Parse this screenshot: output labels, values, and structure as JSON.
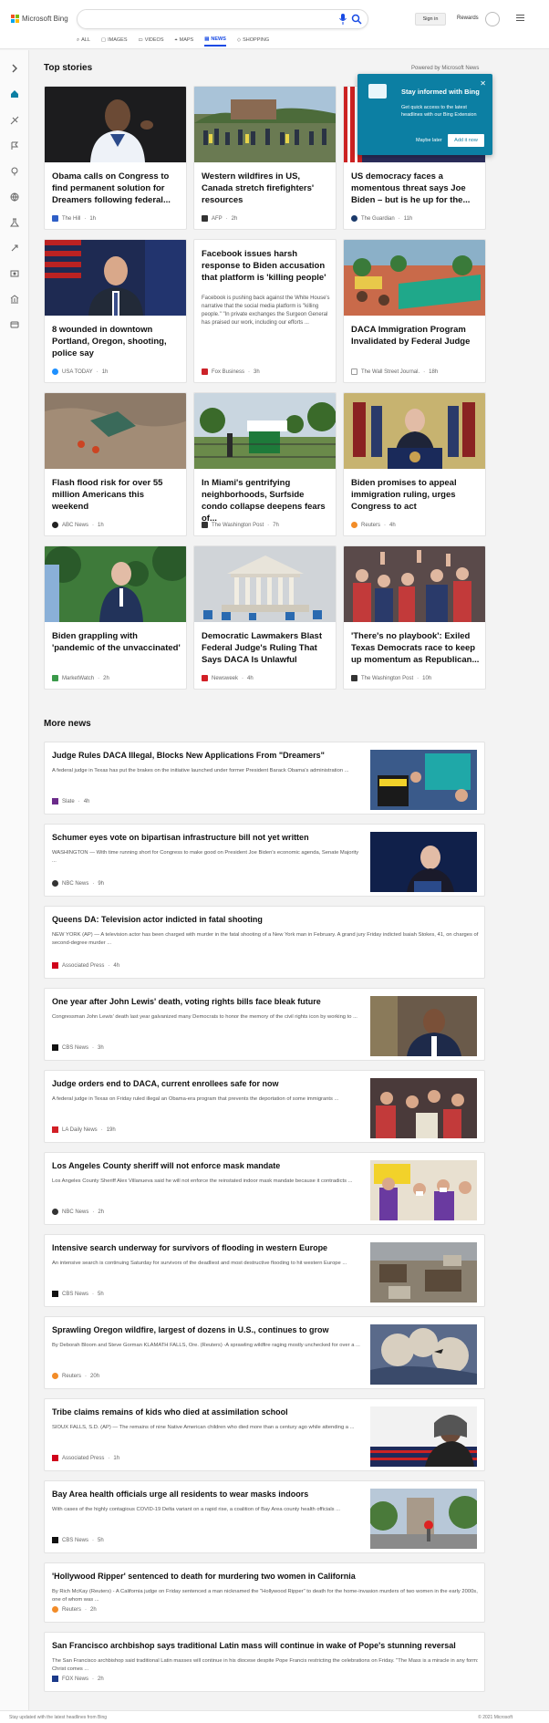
{
  "brand": {
    "name": "Microsoft Bing"
  },
  "header": {
    "signin_label": "Sign in",
    "rewards_label": "Rewards",
    "tabs": [
      {
        "label": "ALL",
        "icon": "search-icon"
      },
      {
        "label": "IMAGES",
        "icon": "image-icon"
      },
      {
        "label": "VIDEOS",
        "icon": "video-icon"
      },
      {
        "label": "MAPS",
        "icon": "map-pin-icon"
      },
      {
        "label": "NEWS",
        "icon": "news-icon",
        "active": true
      },
      {
        "label": "SHOPPING",
        "icon": "tag-icon"
      }
    ]
  },
  "sidebar": {
    "icons": [
      "expand-icon",
      "home-icon",
      "discover-icon",
      "flag-icon",
      "location-icon",
      "world-icon",
      "science-icon",
      "tech-icon",
      "entertainment-icon",
      "business-icon",
      "money-icon"
    ]
  },
  "top_stories": {
    "title": "Top stories",
    "powered_by": "Powered by Microsoft News",
    "cards": [
      {
        "title": "Obama calls on Congress to find permanent solution for Dreamers following federal...",
        "source": "The Hill",
        "time": "1h",
        "color": "#2f5fc7"
      },
      {
        "title": "Western wildfires in US, Canada stretch firefighters' resources",
        "source": "AFP",
        "time": "2h",
        "color": "#333333"
      },
      {
        "title": "US democracy faces a momentous threat says Joe Biden – but is he up for the...",
        "source": "The Guardian",
        "time": "11h",
        "color": "#1b3a6b"
      },
      {
        "title": "8 wounded in downtown Portland, Oregon, shooting, police say",
        "source": "USA TODAY",
        "time": "1h",
        "color": "#1e90ff"
      },
      {
        "title": "Facebook issues harsh response to Biden accusation that platform is 'killing people'",
        "desc": "Facebook is pushing back against the White House's narrative that the social media platform is \"killing people.\" \"In private exchanges the Surgeon General has praised our work, including our efforts ...",
        "source": "Fox Business",
        "time": "3h",
        "color": "#cc2229"
      },
      {
        "title": "DACA Immigration Program Invalidated by Federal Judge",
        "source": "The Wall Street Journal.",
        "time": "18h",
        "color": "#666666"
      },
      {
        "title": "Flash flood risk for over 55 million Americans this weekend",
        "source": "ABC News",
        "time": "1h",
        "color": "#222222"
      },
      {
        "title": "In Miami's gentrifying neighborhoods, Surfside condo collapse deepens fears of...",
        "source": "The Washington Post",
        "time": "7h",
        "color": "#333333"
      },
      {
        "title": "Biden promises to appeal immigration ruling, urges Congress to act",
        "source": "Reuters",
        "time": "4h",
        "color": "#f28c28"
      },
      {
        "title": "Biden grappling with 'pandemic of the unvaccinated'",
        "source": "MarketWatch",
        "time": "2h",
        "color": "#3a9a4a"
      },
      {
        "title": "Democratic Lawmakers Blast Federal Judge's Ruling That Says DACA Is Unlawful",
        "source": "Newsweek",
        "time": "4h",
        "color": "#d21f26"
      },
      {
        "title": "'There's no playbook': Exiled Texas Democrats race to keep up momentum as Republican...",
        "source": "The Washington Post",
        "time": "10h",
        "color": "#333333"
      }
    ]
  },
  "popup": {
    "title": "Stay informed with Bing",
    "desc": "Get quick access to the latest headlines with our Bing Extension",
    "later": "Maybe later",
    "add": "Add it now"
  },
  "more_news": {
    "title": "More news",
    "items": [
      {
        "title": "Judge Rules DACA Illegal, Blocks New Applications From \"Dreamers\"",
        "desc": "A federal judge in Texas has put the brakes on the initiative launched under former President Barack Obama's administration ...",
        "source": "Slate",
        "time": "4h",
        "color": "#6b2b8a"
      },
      {
        "title": "Schumer eyes vote on bipartisan infrastructure bill not yet written",
        "desc": "WASHINGTON — With time running short for Congress to make good on President Joe Biden's economic agenda, Senate Majority ...",
        "source": "NBC News",
        "time": "9h",
        "color": "#333333"
      },
      {
        "title": "Queens DA: Television actor indicted in fatal shooting",
        "desc": "NEW YORK (AP) — A television actor has been charged with murder in the fatal shooting of a New York man in February. A grand jury Friday indicted Isaiah Stokes, 41, on charges of second-degree murder ...",
        "source": "Associated Press",
        "time": "4h",
        "color": "#d0021b"
      },
      {
        "title": "One year after John Lewis' death, voting rights bills face bleak future",
        "desc": "Congressman John Lewis' death last year galvanized many Democrats to honor the memory of the civil rights icon by working to ...",
        "source": "CBS News",
        "time": "3h",
        "color": "#111111"
      },
      {
        "title": "Judge orders end to DACA, current enrollees safe for now",
        "desc": "A federal judge in Texas on Friday ruled illegal an Obama-era program that prevents the deportation of some immigrants ...",
        "source": "LA Daily News",
        "time": "19h",
        "color": "#d21f26"
      },
      {
        "title": "Los Angeles County sheriff will not enforce mask mandate",
        "desc": "Los Angeles County Sheriff Alex Villanueva said he will not enforce the reinstated indoor mask mandate because it contradicts ...",
        "source": "NBC News",
        "time": "2h",
        "color": "#333333"
      },
      {
        "title": "Intensive search underway for survivors of flooding in western Europe",
        "desc": "An intensive search is continuing Saturday for survivors of the deadliest and most destructive flooding to hit western Europe ...",
        "source": "CBS News",
        "time": "5h",
        "color": "#111111"
      },
      {
        "title": "Sprawling Oregon wildfire, largest of dozens in U.S., continues to grow",
        "desc": "By Deborah Bloom and Steve Gorman KLAMATH FALLS, Ore. (Reuters) -A sprawling wildfire raging mostly unchecked for over a ...",
        "source": "Reuters",
        "time": "20h",
        "color": "#f28c28"
      },
      {
        "title": "Tribe claims remains of kids who died at assimilation school",
        "desc": "SIOUX FALLS, S.D. (AP) — The remains of nine Native American children who died more than a century ago while attending a ...",
        "source": "Associated Press",
        "time": "1h",
        "color": "#d0021b"
      },
      {
        "title": "Bay Area health officials urge all residents to wear masks indoors",
        "desc": "With cases of the highly contagious COVID-19 Delta variant on a rapid rise, a coalition of Bay Area county health officials ...",
        "source": "CBS News",
        "time": "5h",
        "color": "#111111"
      },
      {
        "title": "'Hollywood Ripper' sentenced to death for murdering two women in California",
        "desc": "By Rich McKay (Reuters) - A California judge on Friday sentenced a man nicknamed the \"Hollywood Ripper\" to death for the home-invasion murders of two women in the early 2000s, one of whom was ...",
        "source": "Reuters",
        "time": "2h",
        "color": "#f28c28"
      },
      {
        "title": "San Francisco archbishop says traditional Latin mass will continue in wake of Pope's stunning reversal",
        "desc": "The San Francisco archbishop said traditional Latin masses will continue in his diocese despite Pope Francis restricting the celebrations on Friday. \"The Mass is a miracle in any form: Christ comes ...",
        "source": "FOX News",
        "time": "2h",
        "color": "#1b3a8a"
      }
    ]
  },
  "footer": {
    "left": "Stay updated with the latest headlines from Bing",
    "right": "© 2021 Microsoft"
  }
}
